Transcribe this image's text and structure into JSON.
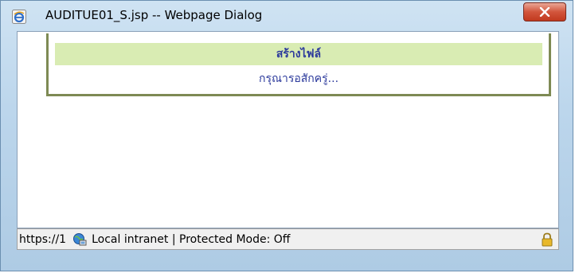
{
  "window": {
    "title": "AUDITUE01_S.jsp -- Webpage Dialog",
    "close_label": "x"
  },
  "message": {
    "header": "สร้างไฟล์",
    "body": "กรุณารอสักครู่..."
  },
  "statusbar": {
    "url": "https://1",
    "zone": "Local intranet | Protected Mode: Off"
  },
  "icons": {
    "window_icon": "ie-icon",
    "zone_icon": "globe-icon",
    "security_icon": "lock-icon"
  },
  "colors": {
    "header_bg": "#d9ecb3",
    "message_text": "#2c3a9c",
    "frame_border": "#7e8a54",
    "close_button": "#c13a1f"
  }
}
